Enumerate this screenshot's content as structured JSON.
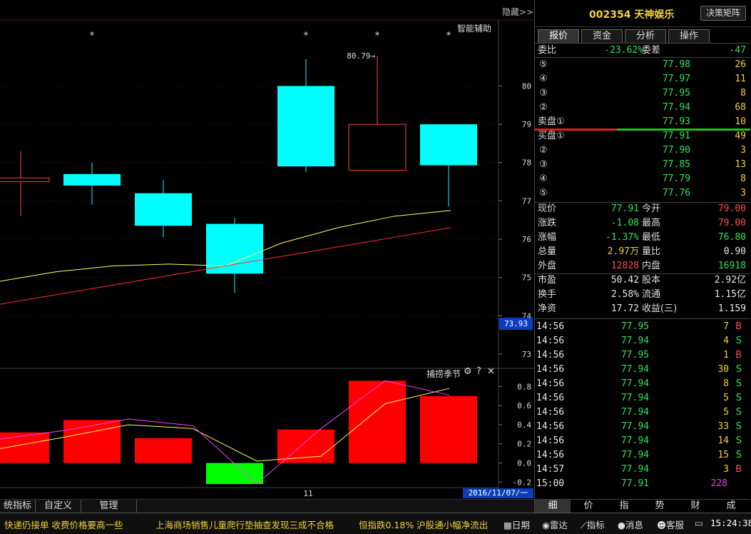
{
  "header": {
    "hide_label": "隐藏>>",
    "smart_aid_label": "智能辅助",
    "stock_title": "002354 天神娱乐",
    "decision_btn": "决策矩阵"
  },
  "chart_data": [
    {
      "type": "candlestick",
      "x_label_center": "11",
      "ylim": [
        72.7,
        81.5
      ],
      "y_ticks": [
        73,
        74,
        75,
        76,
        77,
        78,
        79,
        80
      ],
      "current_price_label": "73.93",
      "date_label": "2016/11/07/一",
      "peak_annotation": "80.79→",
      "candles": [
        {
          "open": 77.6,
          "close": 77.5,
          "high": 78.3,
          "low": 76.6,
          "color": "red",
          "star": false
        },
        {
          "open": 77.4,
          "close": 77.7,
          "high": 78.0,
          "low": 76.9,
          "color": "cyan",
          "star": true
        },
        {
          "open": 77.2,
          "close": 76.35,
          "high": 77.55,
          "low": 76.05,
          "color": "cyan",
          "star": false
        },
        {
          "open": 76.4,
          "close": 75.1,
          "high": 76.55,
          "low": 74.6,
          "color": "cyan",
          "star": false
        },
        {
          "open": 80.0,
          "close": 77.9,
          "high": 80.7,
          "low": 77.75,
          "color": "cyan",
          "star": true
        },
        {
          "open": 77.8,
          "close": 79.0,
          "high": 80.79,
          "low": 77.8,
          "color": "red_hollow",
          "star": true
        },
        {
          "open": 79.0,
          "close": 77.93,
          "high": 79.0,
          "low": 76.85,
          "color": "cyan",
          "star": true
        }
      ],
      "ma_lines": [
        {
          "color": "#ffff66",
          "values": [
            74.9,
            75.15,
            75.3,
            75.35,
            75.3,
            75.9,
            76.3,
            76.6,
            76.75
          ]
        },
        {
          "color": "#ff3030",
          "values": [
            74.3,
            74.55,
            74.8,
            75.05,
            75.3,
            75.55,
            75.8,
            76.05,
            76.3
          ]
        }
      ]
    },
    {
      "type": "bar",
      "title": "捕捞季节",
      "ylim": [
        -0.25,
        0.9
      ],
      "y_ticks": [
        "0.8",
        "0.6",
        "0.4",
        "0.2",
        "0.0",
        "-0.2"
      ],
      "y_tick_values": [
        0.8,
        0.6,
        0.4,
        0.2,
        0.0,
        -0.2
      ],
      "values": [
        0.32,
        0.45,
        0.26,
        -0.22,
        0.35,
        0.86,
        0.7
      ],
      "line_yellow": [
        0.15,
        0.27,
        0.4,
        0.36,
        0.02,
        0.07,
        0.62,
        0.78
      ],
      "line_magenta": [
        0.25,
        0.34,
        0.46,
        0.39,
        -0.22,
        0.36,
        0.86,
        0.71
      ]
    }
  ],
  "left_tabs": [
    "统指标",
    "自定义",
    "管理"
  ],
  "tabs": [
    "报价",
    "资金",
    "分析",
    "操作"
  ],
  "weibi": {
    "label": "委比",
    "value": "-23.62%",
    "label2": "委差",
    "value2": "-47"
  },
  "sell": [
    {
      "idx": "⑤",
      "price": "77.98",
      "vol": "26"
    },
    {
      "idx": "④",
      "price": "77.97",
      "vol": "11"
    },
    {
      "idx": "③",
      "price": "77.95",
      "vol": "8"
    },
    {
      "idx": "②",
      "price": "77.94",
      "vol": "68"
    },
    {
      "idx": "卖盘①",
      "price": "77.93",
      "vol": "10"
    }
  ],
  "buy": [
    {
      "idx": "买盘①",
      "price": "77.91",
      "vol": "49"
    },
    {
      "idx": "②",
      "price": "77.90",
      "vol": "3"
    },
    {
      "idx": "③",
      "price": "77.85",
      "vol": "13"
    },
    {
      "idx": "④",
      "price": "77.79",
      "vol": "8"
    },
    {
      "idx": "⑤",
      "price": "77.76",
      "vol": "3"
    }
  ],
  "quote": [
    {
      "l1": "现价",
      "v1": "77.91",
      "c1": "g",
      "l2": "今开",
      "v2": "79.00",
      "c2": "r"
    },
    {
      "l1": "涨跌",
      "v1": "-1.08",
      "c1": "g",
      "l2": "最高",
      "v2": "79.00",
      "c2": "r"
    },
    {
      "l1": "涨幅",
      "v1": "-1.37%",
      "c1": "g",
      "l2": "最低",
      "v2": "76.80",
      "c2": "g"
    },
    {
      "l1": "总量",
      "v1": "2.97万",
      "c1": "y",
      "l2": "量比",
      "v2": "0.90",
      "c2": "w"
    },
    {
      "l1": "外盘",
      "v1": "12828",
      "c1": "r",
      "l2": "内盘",
      "v2": "16918",
      "c2": "g"
    }
  ],
  "fundamentals": [
    {
      "l1": "市盈",
      "v1": "50.42",
      "l2": "股本",
      "v2": "2.92亿"
    },
    {
      "l1": "换手",
      "v1": "2.58%",
      "l2": "流通",
      "v2": "1.15亿"
    },
    {
      "l1": "净资",
      "v1": "17.72",
      "l2": "收益(三)",
      "v2": "1.159"
    }
  ],
  "ticks": [
    {
      "time": "14:56",
      "price": "77.95",
      "vol": "7",
      "side": "B"
    },
    {
      "time": "14:56",
      "price": "77.94",
      "vol": "4",
      "side": "S"
    },
    {
      "time": "14:56",
      "price": "77.95",
      "vol": "1",
      "side": "B"
    },
    {
      "time": "14:56",
      "price": "77.94",
      "vol": "30",
      "side": "S"
    },
    {
      "time": "14:56",
      "price": "77.94",
      "vol": "8",
      "side": "S"
    },
    {
      "time": "14:56",
      "price": "77.94",
      "vol": "5",
      "side": "S"
    },
    {
      "time": "14:56",
      "price": "77.94",
      "vol": "5",
      "side": "S"
    },
    {
      "time": "14:56",
      "price": "77.94",
      "vol": "33",
      "side": "S"
    },
    {
      "time": "14:56",
      "price": "77.94",
      "vol": "14",
      "side": "S"
    },
    {
      "time": "14:56",
      "price": "77.94",
      "vol": "15",
      "side": "S"
    },
    {
      "time": "14:57",
      "price": "77.94",
      "vol": "3",
      "side": "B"
    },
    {
      "time": "15:00",
      "price": "77.91",
      "vol": "228",
      "side": ""
    }
  ],
  "right_bottom_tabs": [
    "细",
    "价",
    "指",
    "势",
    "财",
    "成"
  ],
  "status": {
    "news1": "快递仍接单 收费价格要高一些",
    "news2": "上海商场销售儿童爬行垫抽查发现三成不合格",
    "index_news": "恒指跌0.18% 沪股通小幅净流出",
    "btns": [
      "日期",
      "雷达",
      "指标",
      "消息",
      "客服"
    ],
    "clock": "15:24:38"
  }
}
